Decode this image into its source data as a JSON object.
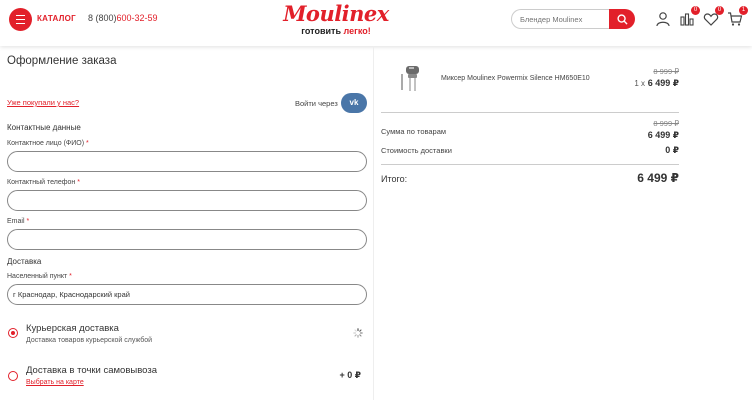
{
  "header": {
    "catalog_label": "КАТАЛОГ",
    "phone_prefix": "8 (800)",
    "phone_number": "600-32-59",
    "logo": "Moulinex",
    "tagline_main": "готовить ",
    "tagline_accent": "легко!",
    "search_placeholder": "Блендер Moulinex",
    "compare_count": "0",
    "favorites_count": "0",
    "cart_count": "1",
    "accent_color": "#e2202a"
  },
  "checkout": {
    "title": "Оформление заказа",
    "bought_link": "Уже покупали у нас?",
    "login_via": "Войти через",
    "vk_label": "vk",
    "contacts_section": "Контактные данные",
    "name_label": "Контактное лицо (ФИО)",
    "phone_label": "Контактный телефон",
    "email_label": "Email",
    "required_mark": "*",
    "name_value": "",
    "phone_value": "",
    "email_value": "",
    "delivery_section": "Доставка",
    "city_label": "Населенный пункт",
    "city_value": "г Краснодар, Краснодарский край",
    "delivery_options": [
      {
        "title": "Курьерская доставка",
        "subtitle": "Доставка товаров курьерской службой",
        "selected": true,
        "price": ""
      },
      {
        "title": "Доставка в точки самовывоза",
        "link": "Выбрать на карте",
        "selected": false,
        "price": "+ 0 ₽"
      }
    ]
  },
  "order": {
    "product_name": "Миксер Moulinex Powermix Silence HM650E10",
    "product_old_price": "8 999 ₽",
    "product_qty": "1 x",
    "product_price": "6 499 ₽",
    "goods_sum_label": "Сумма по товарам",
    "goods_sum_old": "8 999 ₽",
    "goods_sum": "6 499 ₽",
    "delivery_cost_label": "Стоимость доставки",
    "delivery_cost": "0 ₽",
    "total_label": "Итого:",
    "total_value": "6 499 ₽"
  }
}
